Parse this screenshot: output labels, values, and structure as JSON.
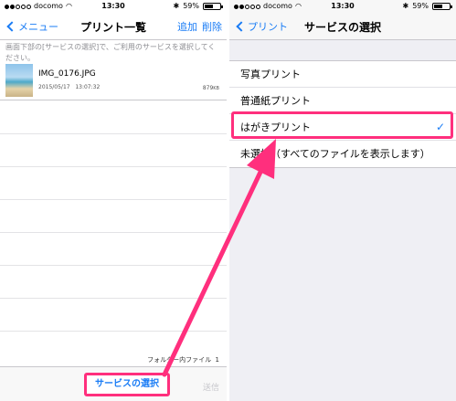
{
  "left": {
    "status": {
      "carrier": "docomo",
      "time": "13:30",
      "battery": "59%",
      "battery_level": 0.59,
      "signal_bars": 2
    },
    "nav": {
      "back_label": "メニュー",
      "title": "プリント一覧",
      "add_label": "追加",
      "delete_label": "削除"
    },
    "note": "画面下部の[サービスの選択]で、ご利用のサービスを選択してください。",
    "file": {
      "name": "IMG_0176.JPG",
      "date": "2015/05/17",
      "time": "13:07:32",
      "size": "879",
      "size_unit": "KB"
    },
    "footer": {
      "label": "フォルダー内ファイル",
      "count": "1"
    },
    "toolbar": {
      "service_label": "サービスの選択",
      "send_label": "送信"
    }
  },
  "right": {
    "status": {
      "carrier": "docomo",
      "time": "13:30",
      "battery": "59%",
      "battery_level": 0.59,
      "signal_bars": 2
    },
    "nav": {
      "back_label": "プリント",
      "title": "サービスの選択"
    },
    "options": [
      {
        "label": "写真プリント"
      },
      {
        "label": "普通紙プリント"
      },
      {
        "label": "はがきプリント",
        "selected": true
      },
      {
        "label": "未選択（すべてのファイルを表示します）"
      }
    ]
  },
  "colors": {
    "accent": "#1a7cf5",
    "highlight": "#ff2f7d"
  }
}
